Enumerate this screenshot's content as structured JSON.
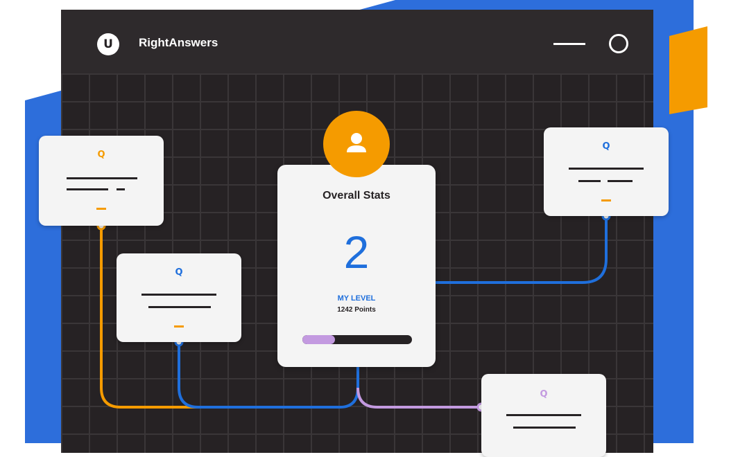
{
  "app": {
    "logo_text": "U",
    "name": "RightAnswers"
  },
  "window_controls": {
    "minimize_icon": "horizontal-line",
    "maximize_icon": "circle-outline"
  },
  "stats": {
    "title": "Overall Stats",
    "level": "2",
    "level_label": "MY LEVEL",
    "points": "1242 Points",
    "progress": 0.3
  },
  "cards": [
    {
      "marker": "Q",
      "marker_color": "#f59b00"
    },
    {
      "marker": "Q",
      "marker_color": "#1f6fdc"
    },
    {
      "marker": "Q",
      "marker_color": "#1f6fdc"
    },
    {
      "marker": "Q",
      "marker_color": "#c39ae0"
    }
  ],
  "colors": {
    "window_bg": "#262224",
    "accent_blue": "#1f6fdc",
    "accent_orange": "#f59b00",
    "accent_purple": "#c39ae0",
    "card_bg": "#f4f4f4"
  },
  "icons": {
    "avatar": "user-icon"
  }
}
